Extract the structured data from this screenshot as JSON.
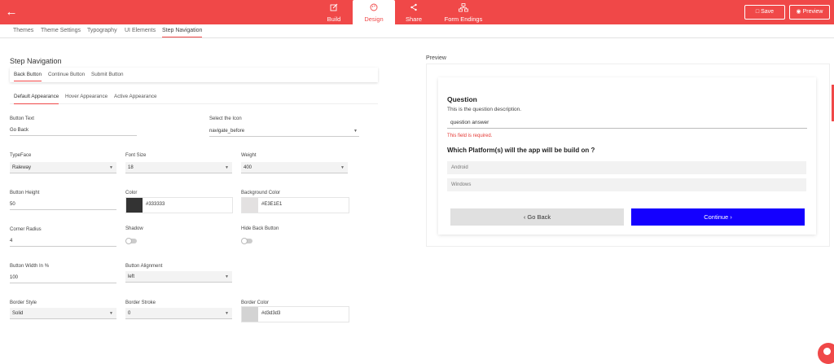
{
  "topbar": {
    "tabs": [
      {
        "label": "Build",
        "icon": "edit-icon"
      },
      {
        "label": "Design",
        "icon": "palette-icon"
      },
      {
        "label": "Share",
        "icon": "share-icon"
      },
      {
        "label": "Form Endings",
        "icon": "flow-icon"
      }
    ],
    "save_label": "Save",
    "preview_label": "Preview",
    "accent": "#f04848"
  },
  "subtabs": [
    "Themes",
    "Theme Settings",
    "Typography",
    "UI Elements",
    "Step Navigation"
  ],
  "step_nav": {
    "title": "Step Navigation",
    "button_tabs": [
      "Back Button",
      "Continue Button",
      "Submit Button"
    ],
    "appearance_tabs": [
      "Default Appearance",
      "Hover Appearance",
      "Active Appearance"
    ]
  },
  "fields": {
    "button_text": {
      "label": "Button Text",
      "value": "Go Back"
    },
    "icon": {
      "label": "Select the Icon",
      "value": "navigate_before"
    },
    "typeface": {
      "label": "TypeFace",
      "value": "Raleway"
    },
    "font_size": {
      "label": "Font Size",
      "value": "18"
    },
    "weight": {
      "label": "Weight",
      "value": "400"
    },
    "button_height": {
      "label": "Button Height",
      "value": "50"
    },
    "color": {
      "label": "Color",
      "value": "#333333"
    },
    "background_color": {
      "label": "Background Color",
      "value": "#E3E1E1"
    },
    "corner_radius": {
      "label": "Corner Radius",
      "value": "4"
    },
    "shadow": {
      "label": "Shadow"
    },
    "hide_back": {
      "label": "Hide Back Button"
    },
    "button_width": {
      "label": "Button Width In %",
      "value": "100"
    },
    "alignment": {
      "label": "Button Alignment",
      "value": "left"
    },
    "border_style": {
      "label": "Border Style",
      "value": "Solid"
    },
    "border_stroke": {
      "label": "Border Stroke",
      "value": "0"
    },
    "border_color": {
      "label": "Border Color",
      "value": "#d3d3d3"
    }
  },
  "preview": {
    "label": "Preview",
    "question": "Question",
    "description": "This is the question description.",
    "answer": "question answer",
    "error": "This field is required.",
    "question2": "Which Platform(s) will the app will be build on ?",
    "options": [
      "Android",
      "Windows"
    ],
    "back_label": "Go Back",
    "continue_label": "Continue",
    "continue_color": "#1400ff"
  }
}
